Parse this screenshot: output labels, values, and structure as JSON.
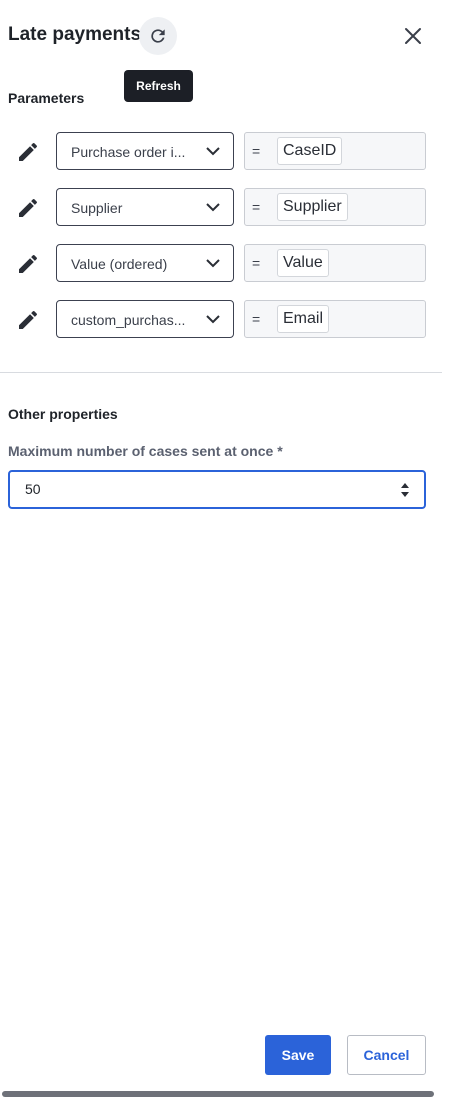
{
  "header": {
    "title": "Late payments",
    "refresh_icon": "refresh-icon",
    "close_icon": "close-icon",
    "tooltip": "Refresh"
  },
  "parameters": {
    "heading": "Parameters",
    "rows": [
      {
        "field": "Purchase order i...",
        "operator": "=",
        "value": "CaseID"
      },
      {
        "field": "Supplier",
        "operator": "=",
        "value": "Supplier"
      },
      {
        "field": "Value (ordered)",
        "operator": "=",
        "value": "Value"
      },
      {
        "field": "custom_purchas...",
        "operator": "=",
        "value": "Email"
      }
    ]
  },
  "other": {
    "heading": "Other properties",
    "max_cases_label": "Maximum number of cases sent at once *",
    "max_cases_value": "50"
  },
  "footer": {
    "save_label": "Save",
    "cancel_label": "Cancel"
  },
  "colors": {
    "accent": "#2b63d9",
    "tooltip_bg": "#1c1f26"
  }
}
